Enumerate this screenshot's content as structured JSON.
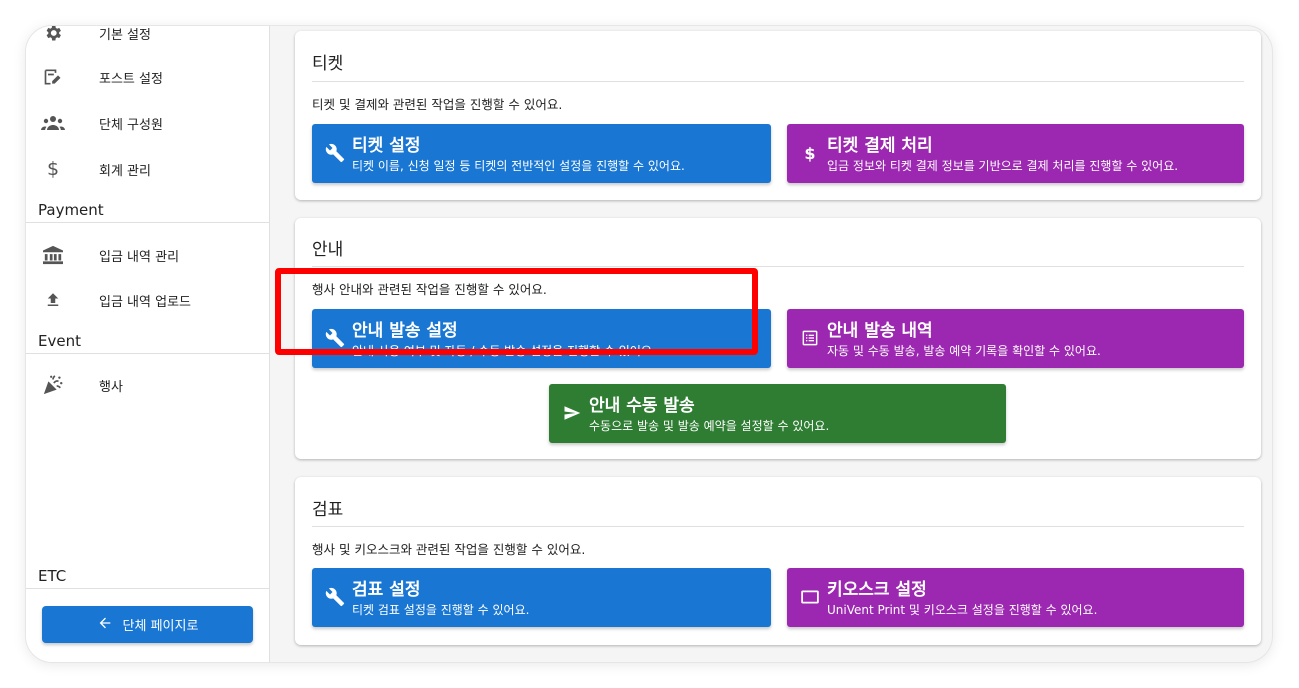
{
  "sidebar": {
    "items_top": [
      {
        "label": "기본 설정",
        "icon": "gear-icon"
      },
      {
        "label": "포스트 설정",
        "icon": "post-edit-icon"
      },
      {
        "label": "단체 구성원",
        "icon": "group-icon"
      },
      {
        "label": "회계 관리",
        "icon": "dollar-icon"
      }
    ],
    "payment_head": "Payment",
    "payment_items": [
      {
        "label": "입금 내역 관리",
        "icon": "bank-icon"
      },
      {
        "label": "입금 내역 업로드",
        "icon": "upload-icon"
      }
    ],
    "event_head": "Event",
    "event_items": [
      {
        "label": "행사",
        "icon": "celebration-icon"
      }
    ],
    "etc_head": "ETC",
    "back_button": "단체 페이지로"
  },
  "ticket": {
    "title": "티켓",
    "desc": "티켓 및 결제와 관련된 작업을 진행할 수 있어요.",
    "actions": [
      {
        "title": "티켓 설정",
        "desc": "티켓 이름, 신청 일정 등 티켓의 전반적인 설정을 진행할 수 있어요.",
        "icon": "wrench-icon"
      },
      {
        "title": "티켓 결제 처리",
        "desc": "입금 정보와 티켓 결제 정보를 기반으로 결제 처리를 진행할 수 있어요.",
        "icon": "dollar-icon"
      }
    ]
  },
  "notice": {
    "title": "안내",
    "desc": "행사 안내와 관련된 작업을 진행할 수 있어요.",
    "actions": [
      {
        "title": "안내 발송 설정",
        "desc": "안내 사용 여부 및 자동 / 수동 발송 설정을 진행할 수 있어요.",
        "icon": "wrench-icon"
      },
      {
        "title": "안내 발송 내역",
        "desc": "자동 및 수동 발송, 발송 예약 기록을 확인할 수 있어요.",
        "icon": "list-icon"
      },
      {
        "title": "안내 수동 발송",
        "desc": "수동으로 발송 및 발송 예약을 설정할 수 있어요.",
        "icon": "send-icon"
      }
    ]
  },
  "checkin": {
    "title": "검표",
    "desc": "행사 및 키오스크와 관련된 작업을 진행할 수 있어요.",
    "actions": [
      {
        "title": "검표 설정",
        "desc": "티켓 검표 설정을 진행할 수 있어요.",
        "icon": "wrench-icon"
      },
      {
        "title": "키오스크 설정",
        "desc": "UniVent Print 및 키오스크 설정을 진행할 수 있어요.",
        "icon": "kiosk-icon"
      }
    ]
  },
  "colors": {
    "primary": "#1976d2",
    "secondary": "#9c27b0",
    "success": "#2e7d32",
    "highlight": "#ff0000"
  }
}
